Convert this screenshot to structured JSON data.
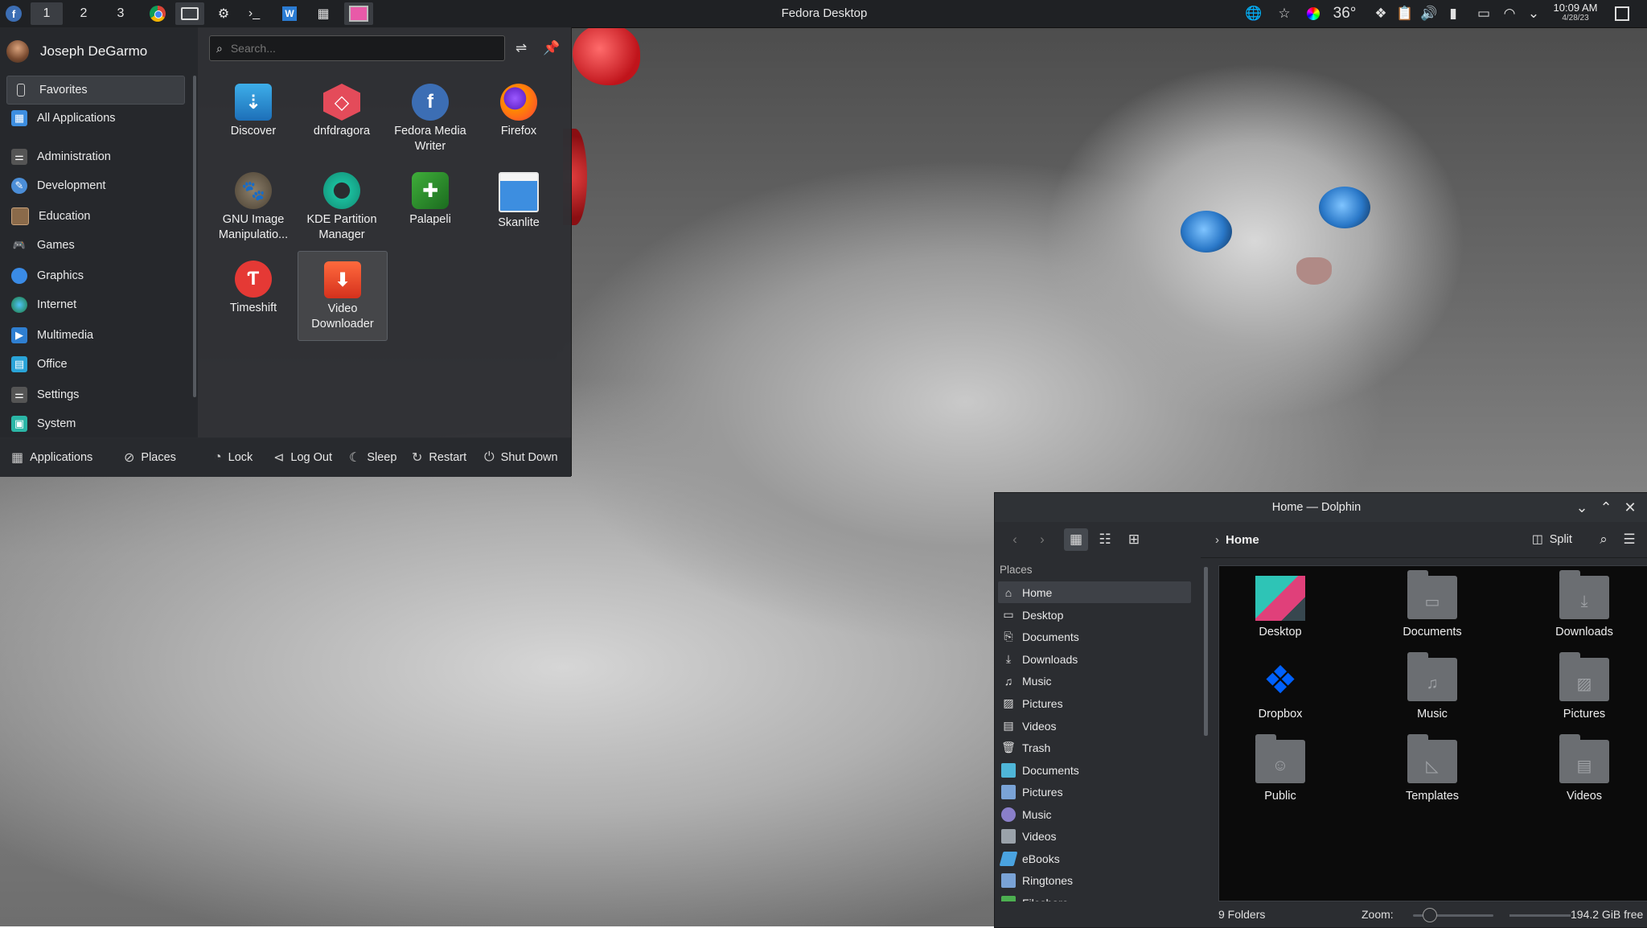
{
  "panel": {
    "workspaces": [
      "1",
      "2",
      "3"
    ],
    "title": "Fedora Desktop",
    "weather": "36°",
    "time": "10:09 AM",
    "date": "4/28/23"
  },
  "launcher": {
    "user_name": "Joseph DeGarmo",
    "search_placeholder": "Search...",
    "categories": [
      {
        "label": "Favorites",
        "icon": "bookmark-icon"
      },
      {
        "label": "All Applications",
        "icon": "grid-icon"
      },
      {
        "label": "Administration",
        "icon": "admin-icon"
      },
      {
        "label": "Development",
        "icon": "development-icon"
      },
      {
        "label": "Education",
        "icon": "education-icon"
      },
      {
        "label": "Games",
        "icon": "gamepad-icon"
      },
      {
        "label": "Graphics",
        "icon": "graphics-icon"
      },
      {
        "label": "Internet",
        "icon": "globe-icon"
      },
      {
        "label": "Multimedia",
        "icon": "multimedia-icon"
      },
      {
        "label": "Office",
        "icon": "office-icon"
      },
      {
        "label": "Settings",
        "icon": "settings-icon"
      },
      {
        "label": "System",
        "icon": "system-icon"
      }
    ],
    "apps": [
      {
        "label": "Discover",
        "icon": "discover-icon"
      },
      {
        "label": "dnfdragora",
        "icon": "dnfdragora-icon"
      },
      {
        "label": "Fedora Media Writer",
        "icon": "fedora-media-writer-icon"
      },
      {
        "label": "Firefox",
        "icon": "firefox-icon"
      },
      {
        "label": "GNU Image Manipulatio...",
        "icon": "gimp-icon"
      },
      {
        "label": "KDE Partition Manager",
        "icon": "partition-manager-icon"
      },
      {
        "label": "Palapeli",
        "icon": "palapeli-icon"
      },
      {
        "label": "Skanlite",
        "icon": "skanlite-icon"
      },
      {
        "label": "Timeshift",
        "icon": "timeshift-icon"
      },
      {
        "label": "Video Downloader",
        "icon": "video-downloader-icon"
      }
    ],
    "bottom": {
      "applications": "Applications",
      "places": "Places",
      "lock": "Lock",
      "logout": "Log Out",
      "sleep": "Sleep",
      "restart": "Restart",
      "shutdown": "Shut Down"
    }
  },
  "dolphin": {
    "title": "Home — Dolphin",
    "breadcrumb": "Home",
    "split_label": "Split",
    "places_header": "Places",
    "places": [
      "Home",
      "Desktop",
      "Documents",
      "Downloads",
      "Music",
      "Pictures",
      "Videos",
      "Trash",
      "Documents",
      "Pictures",
      "Music",
      "Videos",
      "eBooks",
      "Ringtones",
      "Fileshare"
    ],
    "files": [
      {
        "label": "Desktop",
        "icon": "desktop-folder-icon"
      },
      {
        "label": "Documents",
        "icon": "documents-folder-icon"
      },
      {
        "label": "Downloads",
        "icon": "downloads-folder-icon"
      },
      {
        "label": "Dropbox",
        "icon": "dropbox-icon"
      },
      {
        "label": "Music",
        "icon": "music-folder-icon"
      },
      {
        "label": "Pictures",
        "icon": "pictures-folder-icon"
      },
      {
        "label": "Public",
        "icon": "public-folder-icon"
      },
      {
        "label": "Templates",
        "icon": "templates-folder-icon"
      },
      {
        "label": "Videos",
        "icon": "videos-folder-icon"
      }
    ],
    "status": {
      "count": "9 Folders",
      "zoom_label": "Zoom:",
      "free": "194.2 GiB free"
    }
  }
}
